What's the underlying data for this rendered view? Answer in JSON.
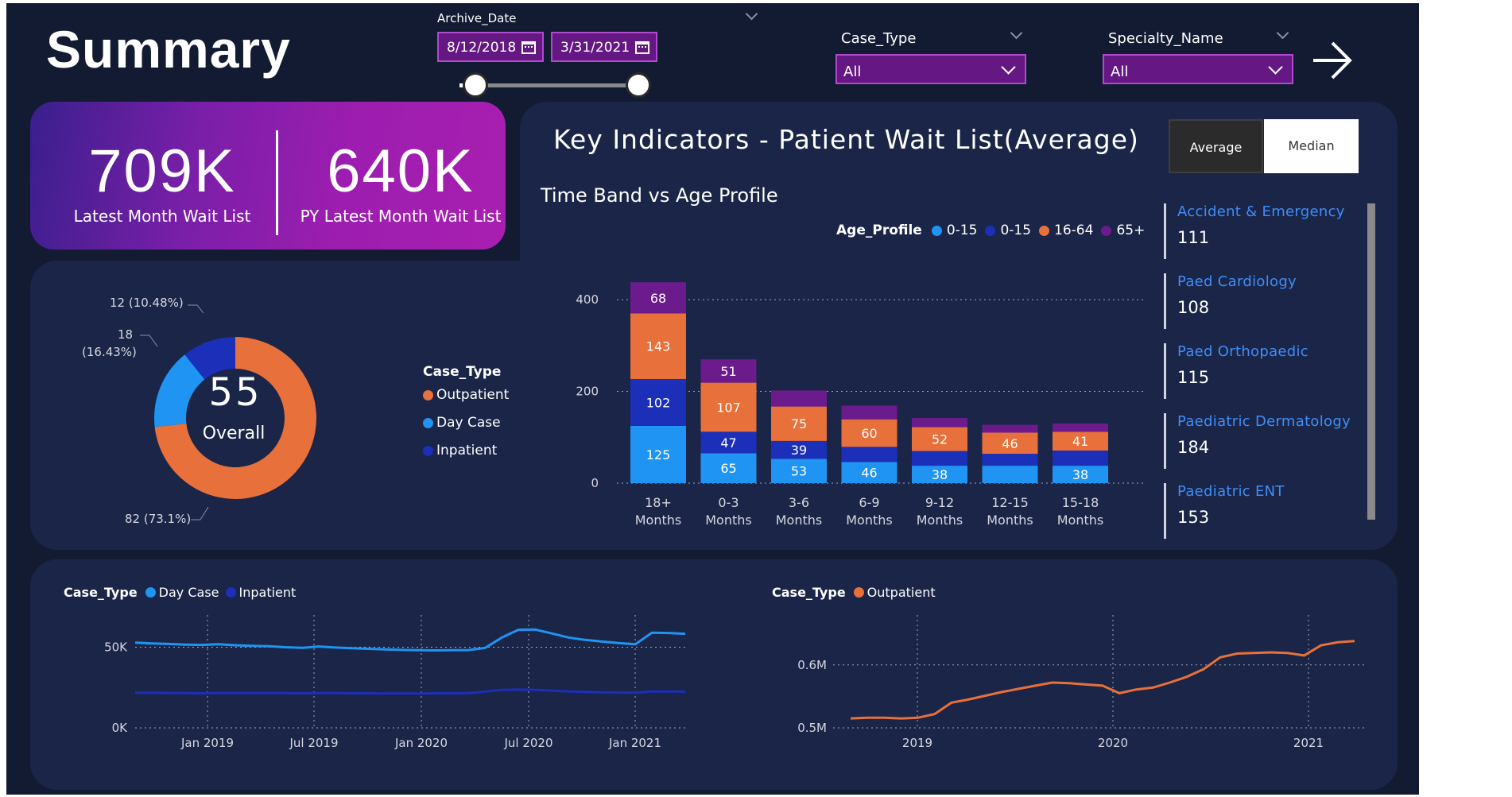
{
  "header": {
    "title": "Summary"
  },
  "filters": {
    "archive_date_label": "Archive_Date",
    "start_date": "8/12/2018",
    "end_date": "3/31/2021",
    "case_type_label": "Case_Type",
    "case_type_value": "All",
    "specialty_label": "Specialty_Name",
    "specialty_value": "All"
  },
  "kpis": {
    "latest_value": "709K",
    "latest_label": "Latest Month Wait List",
    "py_value": "640K",
    "py_label": "PY Latest Month Wait List"
  },
  "key_indicators": {
    "title": "Key Indicators - Patient Wait List(Average)",
    "subtitle": "Time Band vs Age Profile",
    "toggle_average": "Average",
    "toggle_median": "Median"
  },
  "donut": {
    "center_value": "55",
    "center_label": "Overall",
    "legend_title": "Case_Type",
    "labels": {
      "top": "12 (10.48%)",
      "mid_line1": "18",
      "mid_line2": "(16.43%)",
      "bottom": "82 (73.1%)"
    }
  },
  "specialties": [
    {
      "name": "Accident & Emergency",
      "value": "111"
    },
    {
      "name": "Paed Cardiology",
      "value": "108"
    },
    {
      "name": "Paed Orthopaedic",
      "value": "115"
    },
    {
      "name": "Paediatric Dermatology",
      "value": "184"
    },
    {
      "name": "Paediatric ENT",
      "value": "153"
    }
  ],
  "bar_legend": {
    "title": "Age_Profile",
    "items": [
      "0-15",
      "0-15",
      "16-64",
      "65+"
    ]
  },
  "line_left_legend": {
    "title": "Case_Type",
    "items": [
      "Day Case",
      "Inpatient"
    ]
  },
  "line_right_legend": {
    "title": "Case_Type",
    "items": [
      "Outpatient"
    ]
  },
  "colors": {
    "outpatient": "#e8703a",
    "day_case": "#1f94f2",
    "inpatient": "#1b2fb8",
    "age_65plus": "#6b1b8c",
    "accent_purple": "#651883"
  },
  "chart_data": [
    {
      "type": "pie",
      "variant": "donut",
      "categories": [
        "Outpatient",
        "Day Case",
        "Inpatient"
      ],
      "values": [
        82,
        18,
        12
      ],
      "percent": [
        73.1,
        16.43,
        10.48
      ],
      "total": 55
    },
    {
      "type": "bar",
      "stacked": true,
      "categories": [
        "18+ Months",
        "0-3 Months",
        "3-6 Months",
        "6-9 Months",
        "9-12 Months",
        "12-15 Months",
        "15-18 Months"
      ],
      "series": [
        {
          "name": "0-15",
          "values": [
            125,
            65,
            53,
            46,
            38,
            38,
            38
          ],
          "labels": [
            "125",
            "65",
            "53",
            "46",
            "38",
            "",
            "38"
          ]
        },
        {
          "name": "0-15",
          "values": [
            102,
            47,
            39,
            33,
            32,
            26,
            33
          ],
          "labels": [
            "102",
            "47",
            "39",
            "",
            "",
            "",
            ""
          ]
        },
        {
          "name": "16-64",
          "values": [
            143,
            107,
            75,
            60,
            52,
            46,
            41
          ],
          "labels": [
            "143",
            "107",
            "75",
            "60",
            "52",
            "46",
            "41"
          ]
        },
        {
          "name": "65+",
          "values": [
            68,
            51,
            35,
            30,
            20,
            17,
            18
          ],
          "labels": [
            "68",
            "51",
            "",
            "",
            "",
            "",
            ""
          ]
        }
      ],
      "yticks": [
        "0",
        "200",
        "400"
      ],
      "ylim": [
        0,
        440
      ]
    },
    {
      "type": "line",
      "xticks": [
        "Jan 2019",
        "Jul 2019",
        "Jan 2020",
        "Jul 2020",
        "Jan 2021"
      ],
      "yticks": [
        "0K",
        "50K"
      ],
      "ylim": [
        0,
        65000
      ],
      "x": [
        "2018-08",
        "2018-09",
        "2018-10",
        "2018-11",
        "2018-12",
        "2019-01",
        "2019-02",
        "2019-03",
        "2019-04",
        "2019-05",
        "2019-06",
        "2019-07",
        "2019-08",
        "2019-09",
        "2019-10",
        "2019-11",
        "2019-12",
        "2020-01",
        "2020-02",
        "2020-03",
        "2020-04",
        "2020-05",
        "2020-06",
        "2020-07",
        "2020-08",
        "2020-09",
        "2020-10",
        "2020-11",
        "2020-12",
        "2021-01",
        "2021-02",
        "2021-03"
      ],
      "series": [
        {
          "name": "Day Case",
          "values": [
            52800,
            52300,
            52000,
            51600,
            51400,
            51800,
            51200,
            50800,
            50600,
            50000,
            49600,
            50400,
            49800,
            49400,
            49000,
            48600,
            48300,
            48100,
            48000,
            48100,
            48200,
            49600,
            56000,
            60800,
            60900,
            58500,
            56000,
            54500,
            53500,
            52600,
            51800,
            59000,
            58800,
            58300
          ]
        },
        {
          "name": "Inpatient",
          "values": [
            21800,
            21700,
            21600,
            21500,
            21400,
            21500,
            21600,
            21600,
            21500,
            21500,
            21400,
            21500,
            21500,
            21400,
            21400,
            21300,
            21300,
            21300,
            21400,
            21400,
            21500,
            22500,
            23500,
            23800,
            23600,
            23100,
            22600,
            22300,
            22000,
            21900,
            21800,
            22500,
            22500,
            22400
          ]
        }
      ]
    },
    {
      "type": "line",
      "xticks": [
        "2019",
        "2020",
        "2021"
      ],
      "yticks": [
        "0.5M",
        "0.6M"
      ],
      "ylim": [
        0.5,
        0.62
      ],
      "series": [
        {
          "name": "Outpatient",
          "values": [
            0.515,
            0.516,
            0.516,
            0.515,
            0.516,
            0.522,
            0.54,
            0.545,
            0.551,
            0.557,
            0.562,
            0.567,
            0.572,
            0.571,
            0.569,
            0.567,
            0.555,
            0.561,
            0.564,
            0.572,
            0.581,
            0.593,
            0.612,
            0.618,
            0.619,
            0.62,
            0.619,
            0.615,
            0.631,
            0.636,
            0.638
          ]
        }
      ]
    }
  ]
}
